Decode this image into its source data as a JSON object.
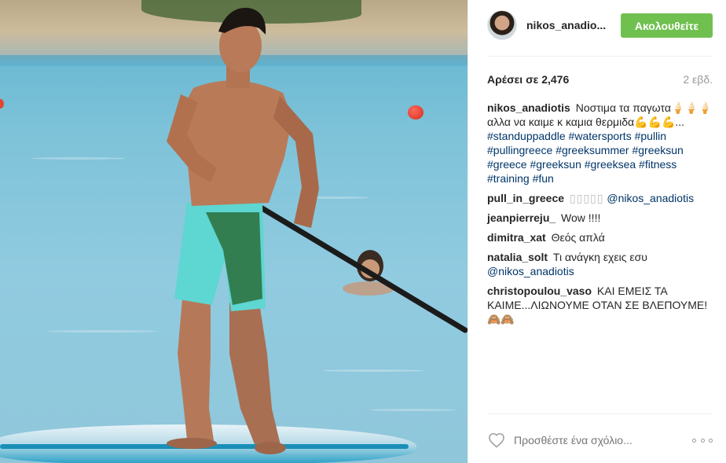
{
  "post": {
    "username": "nikos_anadio...",
    "follow_label": "Ακολουθείτε",
    "likes": "Αρέσει σε 2,476",
    "age": "2 εβδ."
  },
  "caption": {
    "user": "nikos_anadiotis",
    "text": "Νοστιμα τα παγωτα",
    "emoji_1": "🍦🍦🍦",
    "text2": "αλλα να καιμε κ καμια θερμιδα",
    "emoji_2": "💪💪💪",
    "ellipsis": "...",
    "hashtags": [
      "#standuppaddle",
      "#watersports",
      "#pullin",
      "#pullingreece",
      "#greeksummer",
      "#greeksun",
      "#greece",
      "#greeksun",
      "#greeksea",
      "#fitness",
      "#training",
      "#fun"
    ]
  },
  "comments": [
    {
      "user": "pull_in_greece",
      "text": "",
      "emoji": "▯▯▯▯▯",
      "mention": "@nikos_anadiotis"
    },
    {
      "user": "jeanpierreju_",
      "text": "Wow !!!!",
      "emoji": "",
      "mention": ""
    },
    {
      "user": "dimitra_xat",
      "text": "Θεός απλά",
      "emoji": "",
      "mention": ""
    },
    {
      "user": "natalia_solt",
      "text": "Τι ανάγκη εχεις εσυ",
      "emoji": "",
      "mention": "@nikos_anadiotis"
    },
    {
      "user": "christopoulou_vaso",
      "text": "ΚΑΙ ΕΜΕΙΣ ΤΑ ΚΑΙΜΕ...ΛΙΩΝΟΥΜΕ ΟΤΑΝ ΣΕ ΒΛΕΠΟΥΜΕ!",
      "emoji": "🙈🙈",
      "mention": ""
    }
  ],
  "footer": {
    "comment_placeholder": "Προσθέστε ένα σχόλιο...",
    "like_icon": "heart-outline-icon",
    "more_icon": "more-options-icon"
  },
  "colors": {
    "follow_button": "#70c050",
    "link": "#003569",
    "muted": "#999999"
  }
}
